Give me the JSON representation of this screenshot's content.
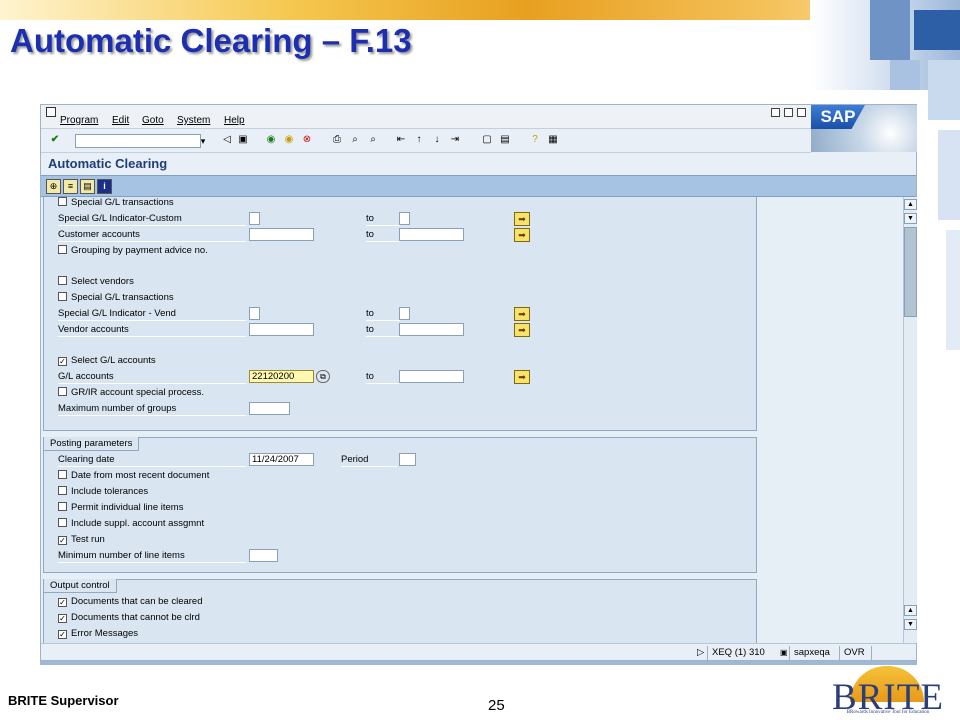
{
  "slide": {
    "title": "Automatic Clearing – F.13",
    "footer_left": "BRITE Supervisor",
    "page_number": "25",
    "logo_text": "BRITE",
    "logo_tagline": "BRowards Innovative Tool for Education"
  },
  "sap": {
    "menu": [
      "Program",
      "Edit",
      "Goto",
      "System",
      "Help"
    ],
    "logo": "SAP",
    "screen_title": "Automatic Clearing",
    "command_field": "",
    "customer_section": {
      "special_gl_transactions": "Special G/L transactions",
      "special_gl_indicator_custom": "Special G/L Indicator-Custom",
      "customer_accounts": "Customer accounts",
      "grouping_by_payment_advice": "Grouping by payment advice no."
    },
    "vendor_section": {
      "select_vendors": "Select vendors",
      "special_gl_transactions": "Special G/L transactions",
      "special_gl_indicator_vend": "Special G/L Indicator - Vend",
      "vendor_accounts": "Vendor accounts"
    },
    "gl_section": {
      "select_gl_accounts": "Select G/L accounts",
      "select_gl_checked": true,
      "gl_accounts_label": "G/L accounts",
      "gl_accounts_from": "22120200",
      "grir_special": "GR/IR account special process.",
      "max_groups": "Maximum number of groups"
    },
    "to_label": "to",
    "posting": {
      "title": "Posting parameters",
      "clearing_date_label": "Clearing date",
      "clearing_date": "11/24/2007",
      "period_label": "Period",
      "date_recent_doc": "Date from most recent document",
      "include_tolerances": "Include tolerances",
      "permit_individual": "Permit individual line items",
      "include_suppl": "Include suppl. account assgmnt",
      "test_run": "Test run",
      "test_run_checked": true,
      "min_line_items": "Minimum number of line items"
    },
    "output": {
      "title": "Output control",
      "docs_cleared": "Documents that can be cleared",
      "docs_not_cleared": "Documents that cannot be clrd",
      "error_messages": "Error Messages"
    },
    "status": {
      "session": "XEQ (1) 310",
      "server": "sapxeqa",
      "mode": "OVR"
    }
  }
}
